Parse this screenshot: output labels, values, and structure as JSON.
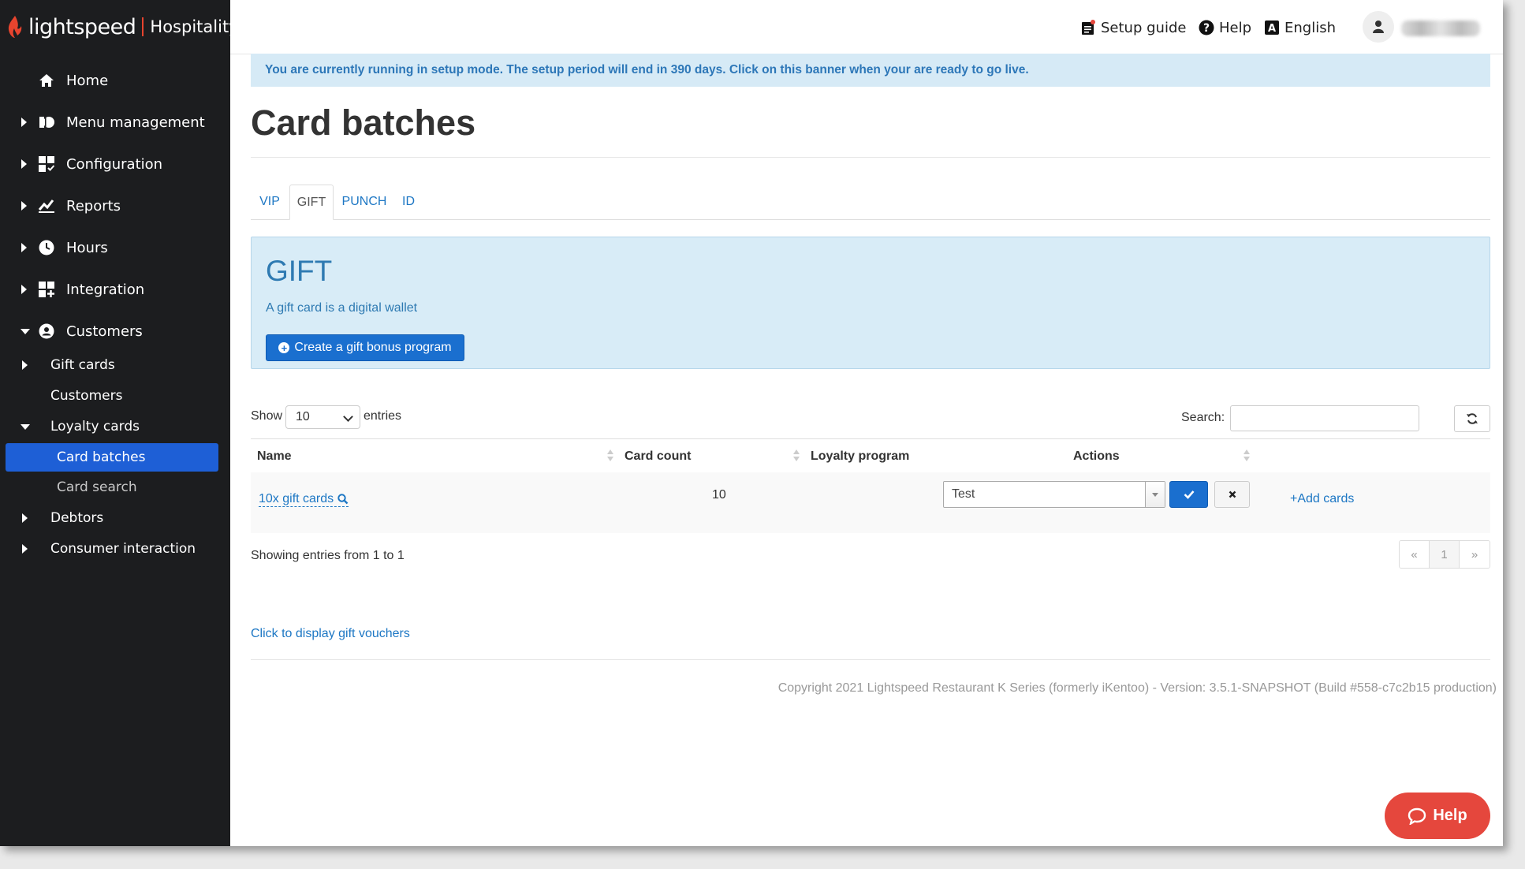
{
  "brand": {
    "name": "lightspeed",
    "suffix": "Hospitality"
  },
  "colors": {
    "sidebar_bg": "#1c1d1f",
    "accent": "#1e5fd6",
    "brand_red": "#e8442e",
    "banner_bg": "#d6eaf6",
    "link": "#1d77c4"
  },
  "topbar": {
    "setup_guide": "Setup guide",
    "help": "Help",
    "language": "English"
  },
  "sidebar": {
    "items": [
      {
        "label": "Home",
        "icon": "home-icon"
      },
      {
        "label": "Menu management",
        "icon": "menu-management-icon"
      },
      {
        "label": "Configuration",
        "icon": "configuration-icon"
      },
      {
        "label": "Reports",
        "icon": "reports-icon"
      },
      {
        "label": "Hours",
        "icon": "clock-icon"
      },
      {
        "label": "Integration",
        "icon": "integration-icon"
      },
      {
        "label": "Customers",
        "icon": "customer-icon"
      }
    ],
    "customers_sub": [
      {
        "label": "Gift cards"
      },
      {
        "label": "Customers"
      },
      {
        "label": "Loyalty cards"
      }
    ],
    "loyalty_sub": [
      {
        "label": "Card batches",
        "active": true
      },
      {
        "label": "Card search"
      }
    ],
    "more_sub": [
      {
        "label": "Debtors"
      },
      {
        "label": "Consumer interaction"
      }
    ]
  },
  "banner": {
    "text": "You are currently running in setup mode. The setup period will end in 390 days. Click on this banner when your are ready to go live."
  },
  "page": {
    "title": "Card batches"
  },
  "tabs": [
    {
      "label": "VIP"
    },
    {
      "label": "GIFT",
      "active": true
    },
    {
      "label": "PUNCH"
    },
    {
      "label": "ID"
    }
  ],
  "gift_panel": {
    "title": "GIFT",
    "description": "A gift card is a digital wallet",
    "create_button": "Create a gift bonus program"
  },
  "table_controls": {
    "show_label": "Show",
    "entries_value": "10",
    "entries_label": "entries",
    "search_label": "Search:",
    "search_value": ""
  },
  "table": {
    "columns": [
      "Name",
      "Card count",
      "Loyalty program",
      "Actions"
    ],
    "rows": [
      {
        "name": "10x gift cards",
        "card_count": "10",
        "loyalty_program": "Test",
        "action": "+Add cards"
      }
    ]
  },
  "showing_text": "Showing entries from 1 to 1",
  "pagination": {
    "prev": "«",
    "page": "1",
    "next": "»"
  },
  "voucher_link": "Click to display gift vouchers",
  "copyright": "Copyright 2021 Lightspeed Restaurant K Series (formerly iKentoo) - Version: 3.5.1-SNAPSHOT (Build #558-c7c2b15 production)",
  "help_fab": {
    "label": "Help"
  }
}
